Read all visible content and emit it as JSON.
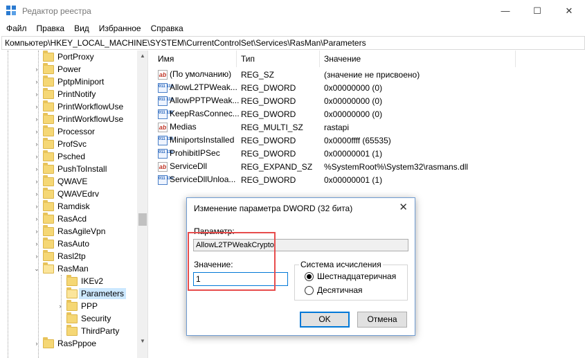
{
  "window": {
    "title": "Редактор реестра",
    "minimize": "—",
    "maximize": "☐",
    "close": "✕"
  },
  "menu": [
    "Файл",
    "Правка",
    "Вид",
    "Избранное",
    "Справка"
  ],
  "address": "Компьютер\\HKEY_LOCAL_MACHINE\\SYSTEM\\CurrentControlSet\\Services\\RasMan\\Parameters",
  "tree": {
    "items": [
      {
        "label": "PortProxy",
        "expander": ""
      },
      {
        "label": "Power",
        "expander": "›"
      },
      {
        "label": "PptpMiniport",
        "expander": "›"
      },
      {
        "label": "PrintNotify",
        "expander": "›"
      },
      {
        "label": "PrintWorkflowUse",
        "expander": "›"
      },
      {
        "label": "PrintWorkflowUse",
        "expander": "›"
      },
      {
        "label": "Processor",
        "expander": "›"
      },
      {
        "label": "ProfSvc",
        "expander": "›"
      },
      {
        "label": "Psched",
        "expander": "›"
      },
      {
        "label": "PushToInstall",
        "expander": "›"
      },
      {
        "label": "QWAVE",
        "expander": "›"
      },
      {
        "label": "QWAVEdrv",
        "expander": "›"
      },
      {
        "label": "Ramdisk",
        "expander": "›"
      },
      {
        "label": "RasAcd",
        "expander": "›"
      },
      {
        "label": "RasAgileVpn",
        "expander": "›"
      },
      {
        "label": "RasAuto",
        "expander": "›"
      },
      {
        "label": "Rasl2tp",
        "expander": "›"
      },
      {
        "label": "RasMan",
        "expander": "⌄"
      }
    ],
    "children": [
      {
        "label": "IKEv2",
        "expander": ""
      },
      {
        "label": "Parameters",
        "expander": ""
      },
      {
        "label": "PPP",
        "expander": "›"
      },
      {
        "label": "Security",
        "expander": ""
      },
      {
        "label": "ThirdParty",
        "expander": ""
      }
    ],
    "next": {
      "label": "RasPppoe",
      "expander": "›"
    }
  },
  "values_table": {
    "headers": [
      "Имя",
      "Тип",
      "Значение"
    ],
    "rows": [
      {
        "icon": "ab",
        "name": "(По умолчанию)",
        "type": "REG_SZ",
        "value": "(значение не присвоено)"
      },
      {
        "icon": "bin",
        "name": "AllowL2TPWeak...",
        "type": "REG_DWORD",
        "value": "0x00000000 (0)"
      },
      {
        "icon": "bin",
        "name": "AllowPPTPWeak...",
        "type": "REG_DWORD",
        "value": "0x00000000 (0)"
      },
      {
        "icon": "bin",
        "name": "KeepRasConnec...",
        "type": "REG_DWORD",
        "value": "0x00000000 (0)"
      },
      {
        "icon": "ab",
        "name": "Medias",
        "type": "REG_MULTI_SZ",
        "value": "rastapi"
      },
      {
        "icon": "bin",
        "name": "MiniportsInstalled",
        "type": "REG_DWORD",
        "value": "0x0000ffff (65535)"
      },
      {
        "icon": "bin",
        "name": "ProhibitIPSec",
        "type": "REG_DWORD",
        "value": "0x00000001 (1)"
      },
      {
        "icon": "ab",
        "name": "ServiceDll",
        "type": "REG_EXPAND_SZ",
        "value": "%SystemRoot%\\System32\\rasmans.dll"
      },
      {
        "icon": "bin",
        "name": "ServiceDllUnloa...",
        "type": "REG_DWORD",
        "value": "0x00000001 (1)"
      }
    ]
  },
  "dialog": {
    "title": "Изменение параметра DWORD (32 бита)",
    "close": "✕",
    "name_label": "Параметр:",
    "name_value": "AllowL2TPWeakCrypto",
    "value_label": "Значение:",
    "value": "1",
    "base_group": "Система исчисления",
    "radio_hex": "Шестнадцатеричная",
    "radio_dec": "Десятичная",
    "ok": "OK",
    "cancel": "Отмена"
  },
  "icons": {
    "ab": "ab",
    "bin": "011\n110"
  }
}
